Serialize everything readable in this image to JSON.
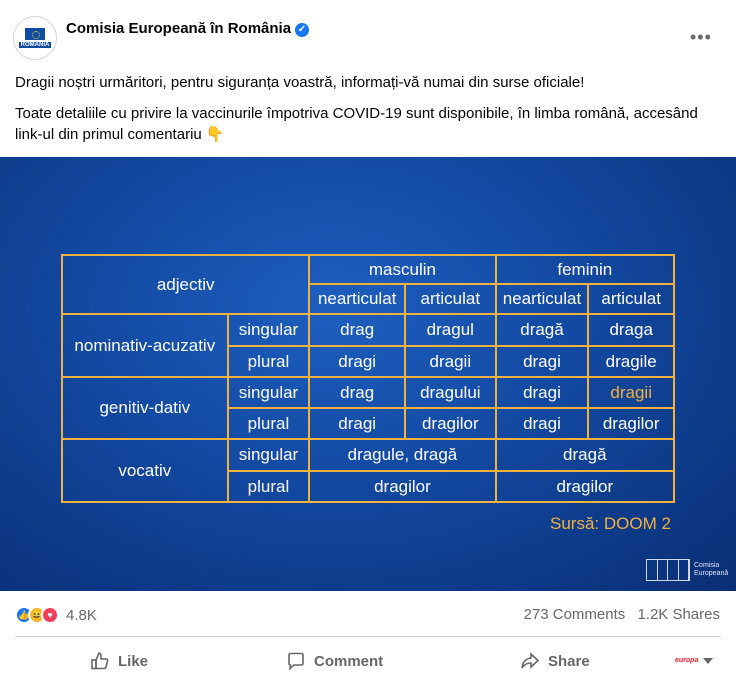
{
  "post": {
    "page_name": "Comisia Europeană în România",
    "avatar_label": "ROMÂNIA",
    "more_glyph": "•••",
    "text_line1": "Dragii noștri urmăritori, pentru siguranța voastră, informați-vă numai din surse oficiale!",
    "text_line2": "Toate detaliile cu privire la vaccinurile împotriva COVID-19 sunt disponibile, în limba română, accesând link-ul din primul comentariu 👇"
  },
  "image": {
    "headers": {
      "adjectiv": "adjectiv",
      "masculin": "masculin",
      "feminin": "feminin",
      "m_nearticulat": "nearticulat",
      "m_articulat": "articulat",
      "f_nearticulat": "nearticulat",
      "f_articulat": "articulat"
    },
    "cases": {
      "nominativ": "nominativ-acuzativ",
      "genitiv": "genitiv-dativ",
      "vocativ": "vocativ"
    },
    "numbers": {
      "singular": "singular",
      "plural": "plural"
    },
    "rows": {
      "nom_sg": [
        "drag",
        "dragul",
        "dragă",
        "draga"
      ],
      "nom_pl": [
        "dragi",
        "dragii",
        "dragi",
        "dragile"
      ],
      "gen_sg": [
        "drag",
        "dragului",
        "dragi",
        "dragii"
      ],
      "gen_pl": [
        "dragi",
        "dragilor",
        "dragi",
        "dragilor"
      ],
      "voc_sg": [
        "dragule, dragă",
        "dragă"
      ],
      "voc_pl": [
        "dragilor",
        "dragilor"
      ]
    },
    "source": "Sursă: DOOM 2",
    "logo_text": [
      "Comisia",
      "Europeană"
    ],
    "accent_color": "#f1b13e"
  },
  "footer": {
    "reaction_icons": [
      "like-icon",
      "haha-icon",
      "love-icon"
    ],
    "reaction_count": "4.8K",
    "comments": "273 Comments",
    "shares": "1.2K Shares",
    "like_label": "Like",
    "comment_label": "Comment",
    "share_label": "Share",
    "profile_mini": "europa"
  }
}
